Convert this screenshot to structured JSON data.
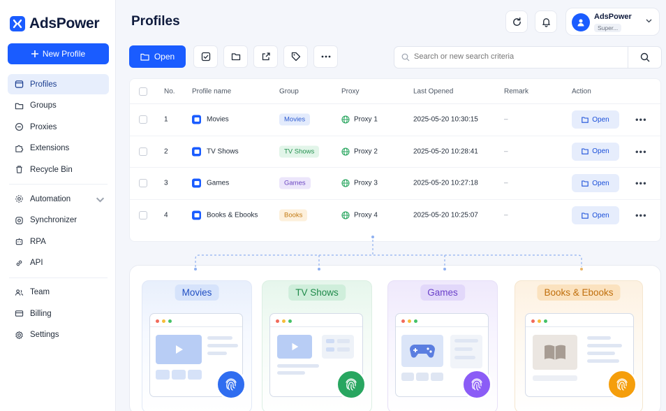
{
  "app": {
    "name": "AdsPower"
  },
  "sidebar": {
    "new_profile_label": "New Profile",
    "items": [
      {
        "label": "Profiles",
        "icon": "profiles-icon",
        "active": true
      },
      {
        "label": "Groups",
        "icon": "folder-icon"
      },
      {
        "label": "Proxies",
        "icon": "proxy-icon"
      },
      {
        "label": "Extensions",
        "icon": "puzzle-icon"
      },
      {
        "label": "Recycle Bin",
        "icon": "trash-icon"
      },
      {
        "label": "Automation",
        "icon": "automation-icon"
      },
      {
        "label": "Synchronizer",
        "icon": "sync-icon"
      },
      {
        "label": "RPA",
        "icon": "rpa-icon"
      },
      {
        "label": "API",
        "icon": "link-icon"
      },
      {
        "label": "Team",
        "icon": "team-icon"
      },
      {
        "label": "Billing",
        "icon": "billing-icon"
      },
      {
        "label": "Settings",
        "icon": "gear-icon"
      }
    ]
  },
  "header": {
    "title": "Profiles",
    "account_name": "AdsPower",
    "account_role": "Super..."
  },
  "toolbar": {
    "open_label": "Open",
    "search_placeholder": "Search or new search criteria"
  },
  "table": {
    "columns": [
      "No.",
      "Profile name",
      "Group",
      "Proxy",
      "Last Opened",
      "Remark",
      "Action"
    ],
    "rows": [
      {
        "no": "1",
        "name": "Movies",
        "group": "Movies",
        "proxy": "Proxy 1",
        "last_opened": "2025-05-20 10:30:15",
        "remark": "–",
        "action": "Open"
      },
      {
        "no": "2",
        "name": "TV Shows",
        "group": "TV Shows",
        "proxy": "Proxy 2",
        "last_opened": "2025-05-20 10:28:41",
        "remark": "–",
        "action": "Open"
      },
      {
        "no": "3",
        "name": "Games",
        "group": "Games",
        "proxy": "Proxy 3",
        "last_opened": "2025-05-20 10:27:18",
        "remark": "–",
        "action": "Open"
      },
      {
        "no": "4",
        "name": "Books & Ebooks",
        "group": "Books",
        "proxy": "Proxy 4",
        "last_opened": "2025-05-20 10:25:07",
        "remark": "–",
        "action": "Open"
      }
    ]
  },
  "cards": [
    {
      "title": "Movies",
      "accent": "#2f6df0"
    },
    {
      "title": "TV Shows",
      "accent": "#28a660"
    },
    {
      "title": "Games",
      "accent": "#8b5cf6"
    },
    {
      "title": "Books & Ebooks",
      "accent": "#f59e0b"
    }
  ],
  "colors": {
    "brand": "#1a5cff",
    "tag_movies_bg": "#e3ebfc",
    "tag_movies_fg": "#2d5bd1",
    "tag_tv_bg": "#e2f5e9",
    "tag_tv_fg": "#23904f",
    "tag_games_bg": "#ece6fb",
    "tag_games_fg": "#6b46c1",
    "tag_books_bg": "#fdf0dc",
    "tag_books_fg": "#c27a12"
  }
}
